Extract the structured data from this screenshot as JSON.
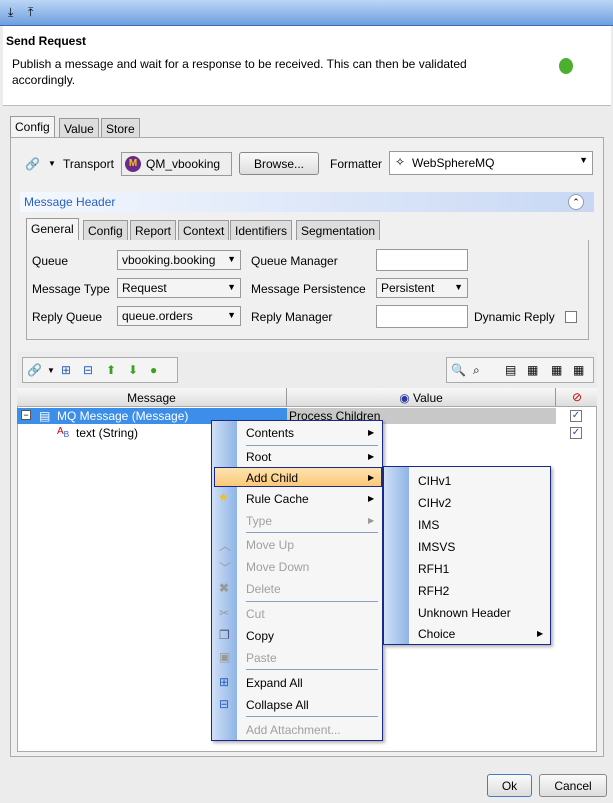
{
  "toolbar_top": {
    "icons": [
      "import-icon",
      "export-icon"
    ]
  },
  "header": {
    "title": "Send Request",
    "description": "Publish a message and wait for a response to be received.  This can then be validated accordingly."
  },
  "tabs": [
    {
      "label": "Config",
      "active": true
    },
    {
      "label": "Value"
    },
    {
      "label": "Store"
    }
  ],
  "transport": {
    "label": "Transport",
    "value": "QM_vbooking",
    "browse": "Browse...",
    "formatter_label": "Formatter",
    "formatter_value": "WebSphereMQ"
  },
  "message_header": {
    "title": "Message Header",
    "tabs": [
      "General",
      "Config",
      "Report",
      "Context",
      "Identifiers",
      "Segmentation"
    ],
    "fields": {
      "queue_label": "Queue",
      "queue": "vbooking.booking",
      "qm_label": "Queue Manager",
      "qm": "",
      "type_label": "Message Type",
      "type": "Request",
      "persist_label": "Message Persistence",
      "persist": "Persistent",
      "reply_queue_label": "Reply Queue",
      "reply_queue": "queue.orders",
      "reply_mgr_label": "Reply Manager",
      "reply_mgr": "",
      "dynamic_label": "Dynamic Reply",
      "dynamic": false
    }
  },
  "tree": {
    "columns": [
      "Message",
      "Value"
    ],
    "rows": [
      {
        "label": "MQ Message (Message)",
        "value": "Process Children",
        "checked": true,
        "selected": true
      },
      {
        "label": "text (String)",
        "value": "",
        "checked": true
      }
    ]
  },
  "context_menu": {
    "items": [
      "Contents",
      "Root",
      "Add Child",
      "Rule Cache",
      "Type",
      "Move Up",
      "Move Down",
      "Delete",
      "Cut",
      "Copy",
      "Paste",
      "Expand All",
      "Collapse All",
      "Add Attachment..."
    ],
    "highlighted": "Add Child"
  },
  "submenu": {
    "items": [
      "CIHv1",
      "CIHv2",
      "IMS",
      "IMSVS",
      "RFH1",
      "RFH2",
      "Unknown Header",
      "Choice"
    ]
  },
  "footer": {
    "ok": "Ok",
    "cancel": "Cancel"
  },
  "colors": {
    "selection": "#3d8ee8",
    "menu_highlight": "#fcd18a",
    "accent": "#1b2a8a"
  }
}
